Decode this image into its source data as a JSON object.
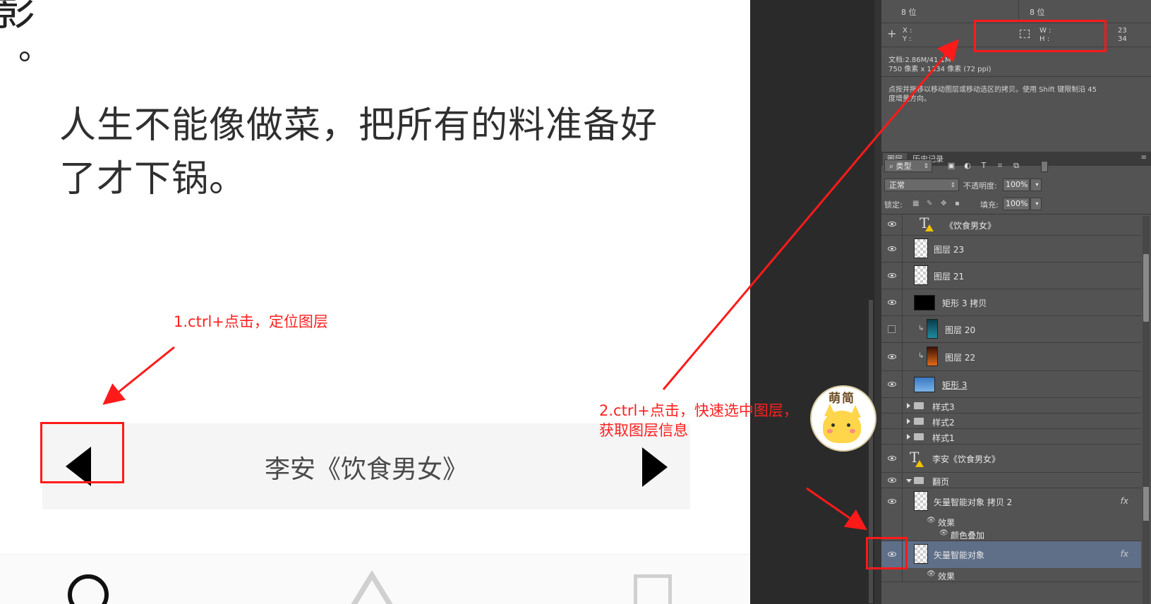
{
  "canvas": {
    "partial_char": "影",
    "partial_mark": "。",
    "quote_line1": "人生不能像做菜，把所有的料准备好",
    "quote_line2": "了才下锅。",
    "nav_title": "李安《饮食男女》"
  },
  "annotations": {
    "step1": "1.ctrl+点击，定位图层",
    "step2_line1": "2.ctrl+点击，快速选中图层，",
    "step2_line2": "获取图层信息",
    "color": "#ff2020"
  },
  "info_panel": {
    "bits_left": "8 位",
    "bits_right": "8 位",
    "x_label": "X :",
    "y_label": "Y :",
    "w_label": "W :",
    "h_label": "H :",
    "w_value": "23",
    "h_value": "34",
    "doc_size": "文档:2.86M/41.1M",
    "pixels": "750 像素 x 1334 像素 (72 ppi)",
    "hint_line1": "点按并拖移以移动图层或移动选区的拷贝。使用 Shift 键限制沿 45",
    "hint_line2": "度增量方向。"
  },
  "layers_panel": {
    "tab_layers": "图层",
    "tab_history": "历史记录",
    "filter_kind": "类型",
    "blend_mode": "正常",
    "opacity_label": "不透明度:",
    "opacity_value": "100%",
    "lock_label": "锁定:",
    "fill_label": "填充:",
    "fill_value": "100%",
    "layers": {
      "l0": "《饮食男女》",
      "l1": "图层 23",
      "l2": "图层 21",
      "l3": "矩形 3 拷贝",
      "l4": "图层 20",
      "l5": "图层 22",
      "l6": "矩形 3",
      "l7": "样式3",
      "l8": "样式2",
      "l9": "样式1",
      "l10": "李安《饮食男女》",
      "l11": "翻页",
      "l12": "矢量智能对象 拷贝 2",
      "l12_effects": "效果",
      "l12_effect1": "颜色叠加",
      "l13": "矢量智能对象",
      "l13_effects": "效果"
    },
    "fx": "fx"
  },
  "mascot": {
    "text": "萌简"
  }
}
